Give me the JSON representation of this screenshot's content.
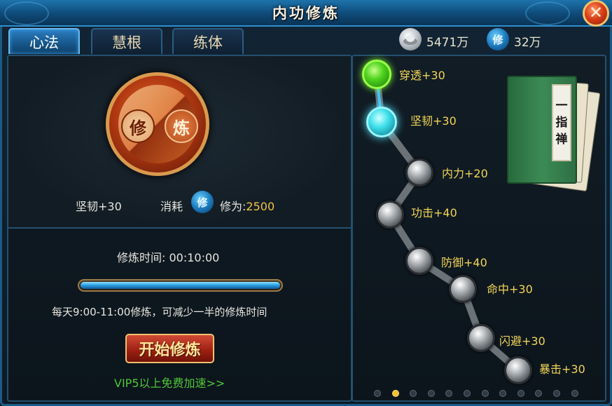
{
  "window": {
    "title": "内功修炼",
    "close_symbol": "✕"
  },
  "tabs": [
    {
      "label": "心法",
      "active": true
    },
    {
      "label": "慧根",
      "active": false
    },
    {
      "label": "练体",
      "active": false
    }
  ],
  "currency": {
    "silver": {
      "icon": "silver-ingot-icon",
      "value": "5471万"
    },
    "xiuwei": {
      "icon": "xiu-icon",
      "icon_char": "修",
      "value": "32万"
    }
  },
  "cultivate": {
    "center_chars": [
      "修",
      "炼"
    ],
    "current_stat": "坚韧+30",
    "cost_label": "消耗",
    "cost_name": "修为:",
    "cost_value": "2500",
    "time_label": "修炼时间: 00:10:00",
    "progress": 1.0,
    "tip": "每天9:00-11:00修炼，可减少一半的修炼时间",
    "start_button": "开始修炼",
    "vip_link": "VIP5以上免费加速>>"
  },
  "meridian": {
    "nodes": [
      {
        "label": "穿透+30",
        "state": "done"
      },
      {
        "label": "坚韧+30",
        "state": "current"
      },
      {
        "label": "内力+20",
        "state": "locked"
      },
      {
        "label": "功击+40",
        "state": "locked"
      },
      {
        "label": "防御+40",
        "state": "locked"
      },
      {
        "label": "命中+30",
        "state": "locked"
      },
      {
        "label": "闪避+30",
        "state": "locked"
      },
      {
        "label": "暴击+30",
        "state": "locked"
      }
    ],
    "book_chars": [
      "一",
      "指",
      "禅"
    ]
  },
  "pagination": {
    "count": 12,
    "active": 2
  },
  "colors": {
    "accent_blue": "#2c7dc2",
    "gold_text": "#f2c44a",
    "label_yellow": "#f2d558",
    "vip_green": "#4ec638"
  }
}
